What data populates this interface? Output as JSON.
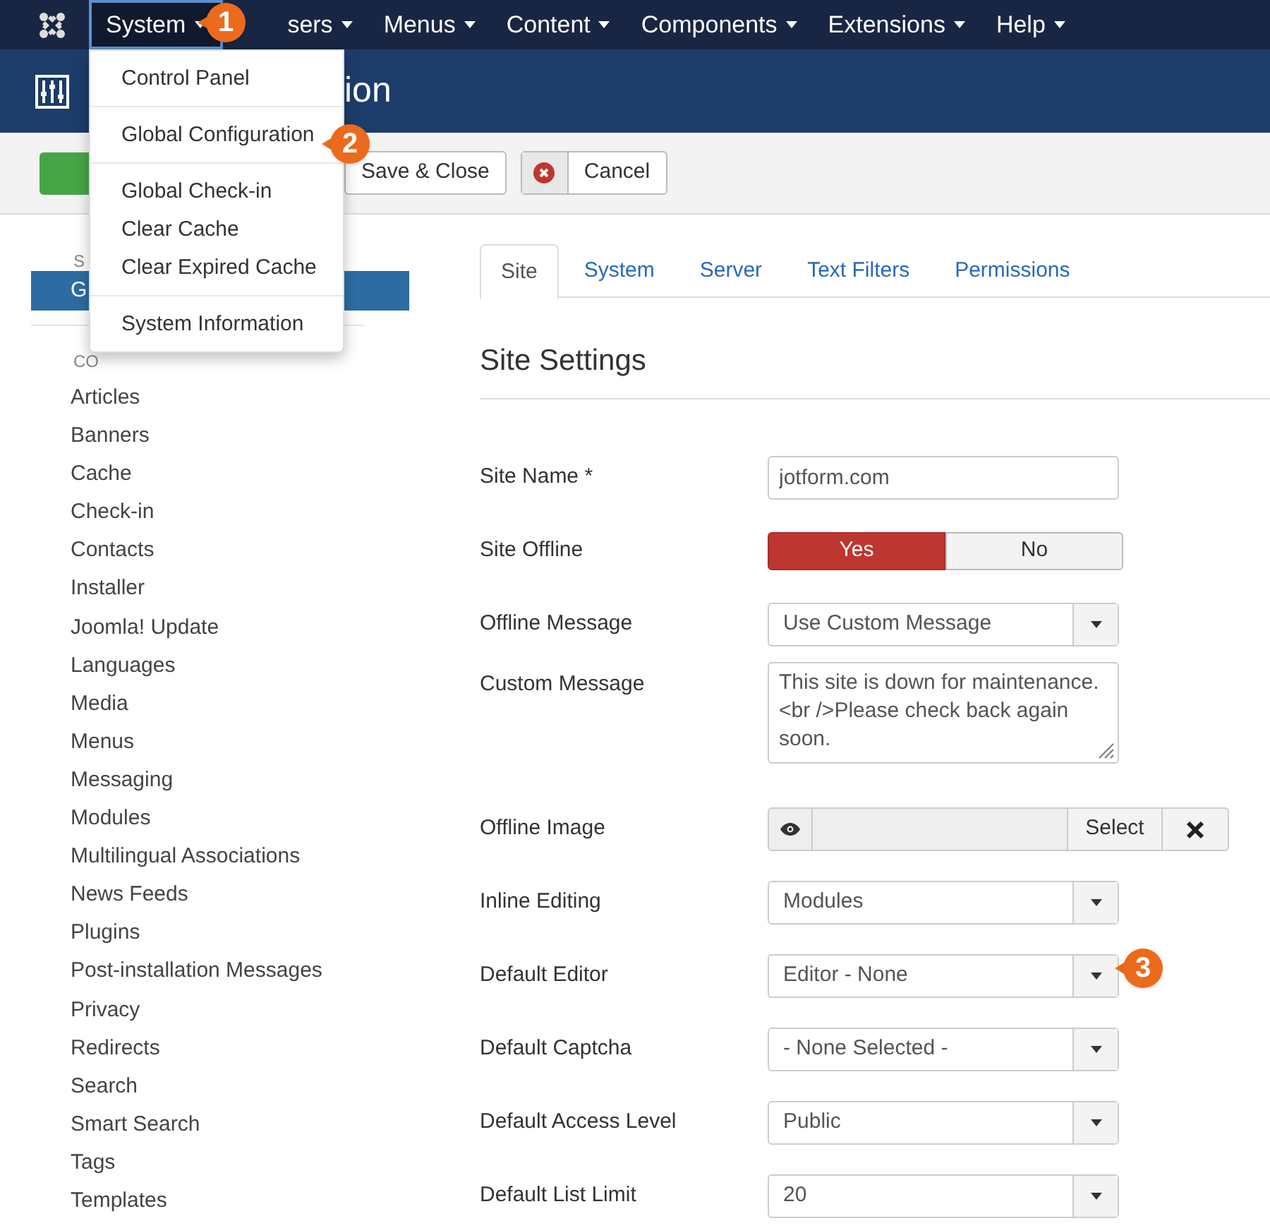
{
  "topbar": {
    "menus": [
      {
        "label": "System",
        "selected": true
      },
      {
        "label": "sers",
        "selected": false
      },
      {
        "label": "Menus",
        "selected": false
      },
      {
        "label": "Content",
        "selected": false
      },
      {
        "label": "Components",
        "selected": false
      },
      {
        "label": "Extensions",
        "selected": false
      },
      {
        "label": "Help",
        "selected": false
      }
    ]
  },
  "dropdown": {
    "sections": [
      {
        "items": [
          "Control Panel"
        ]
      },
      {
        "items": [
          "Global Configuration"
        ]
      },
      {
        "items": [
          "Global Check-in",
          "Clear Cache",
          "Clear Expired Cache"
        ]
      },
      {
        "items": [
          "System Information"
        ]
      }
    ]
  },
  "header": {
    "title": "ion"
  },
  "toolbar": {
    "buttons": [
      {
        "label": "Save & Close",
        "kind": "plain"
      },
      {
        "label": "Cancel",
        "kind": "cancel"
      }
    ]
  },
  "sidebar": {
    "system_heading": "S",
    "active_item": "G",
    "components_heading": "CO",
    "items": [
      "Articles",
      "Banners",
      "Cache",
      "Check-in",
      "Contacts",
      "Installer",
      "Joomla! Update",
      "Languages",
      "Media",
      "Menus",
      "Messaging",
      "Modules",
      "Multilingual Associations",
      "News Feeds",
      "Plugins",
      "Post-installation Messages",
      "Privacy",
      "Redirects",
      "Search",
      "Smart Search",
      "Tags",
      "Templates"
    ]
  },
  "tabs": [
    {
      "label": "Site",
      "selected": true
    },
    {
      "label": "System",
      "selected": false
    },
    {
      "label": "Server",
      "selected": false
    },
    {
      "label": "Text Filters",
      "selected": false
    },
    {
      "label": "Permissions",
      "selected": false
    }
  ],
  "section_title": "Site Settings",
  "fields": [
    {
      "label": "Site Name *",
      "kind": "text",
      "value": "jotform.com"
    },
    {
      "label": "Site Offline",
      "kind": "toggle",
      "options": [
        {
          "label": "Yes",
          "selected": true
        },
        {
          "label": "No",
          "selected": false
        }
      ]
    },
    {
      "label": "Offline Message",
      "kind": "select",
      "value": "Use Custom Message"
    },
    {
      "label": "Custom Message",
      "kind": "textarea",
      "value": "This site is down for maintenance.<br />Please check back again soon."
    },
    {
      "label": "Offline Image",
      "kind": "media",
      "button": "Select"
    },
    {
      "label": "Inline Editing",
      "kind": "select",
      "value": "Modules"
    },
    {
      "label": "Default Editor",
      "kind": "select",
      "value": "Editor - None"
    },
    {
      "label": "Default Captcha",
      "kind": "select",
      "value": "- None Selected -"
    },
    {
      "label": "Default Access Level",
      "kind": "select",
      "value": "Public"
    },
    {
      "label": "Default List Limit",
      "kind": "select",
      "value": "20"
    }
  ],
  "callouts": [
    "1",
    "2",
    "3"
  ]
}
